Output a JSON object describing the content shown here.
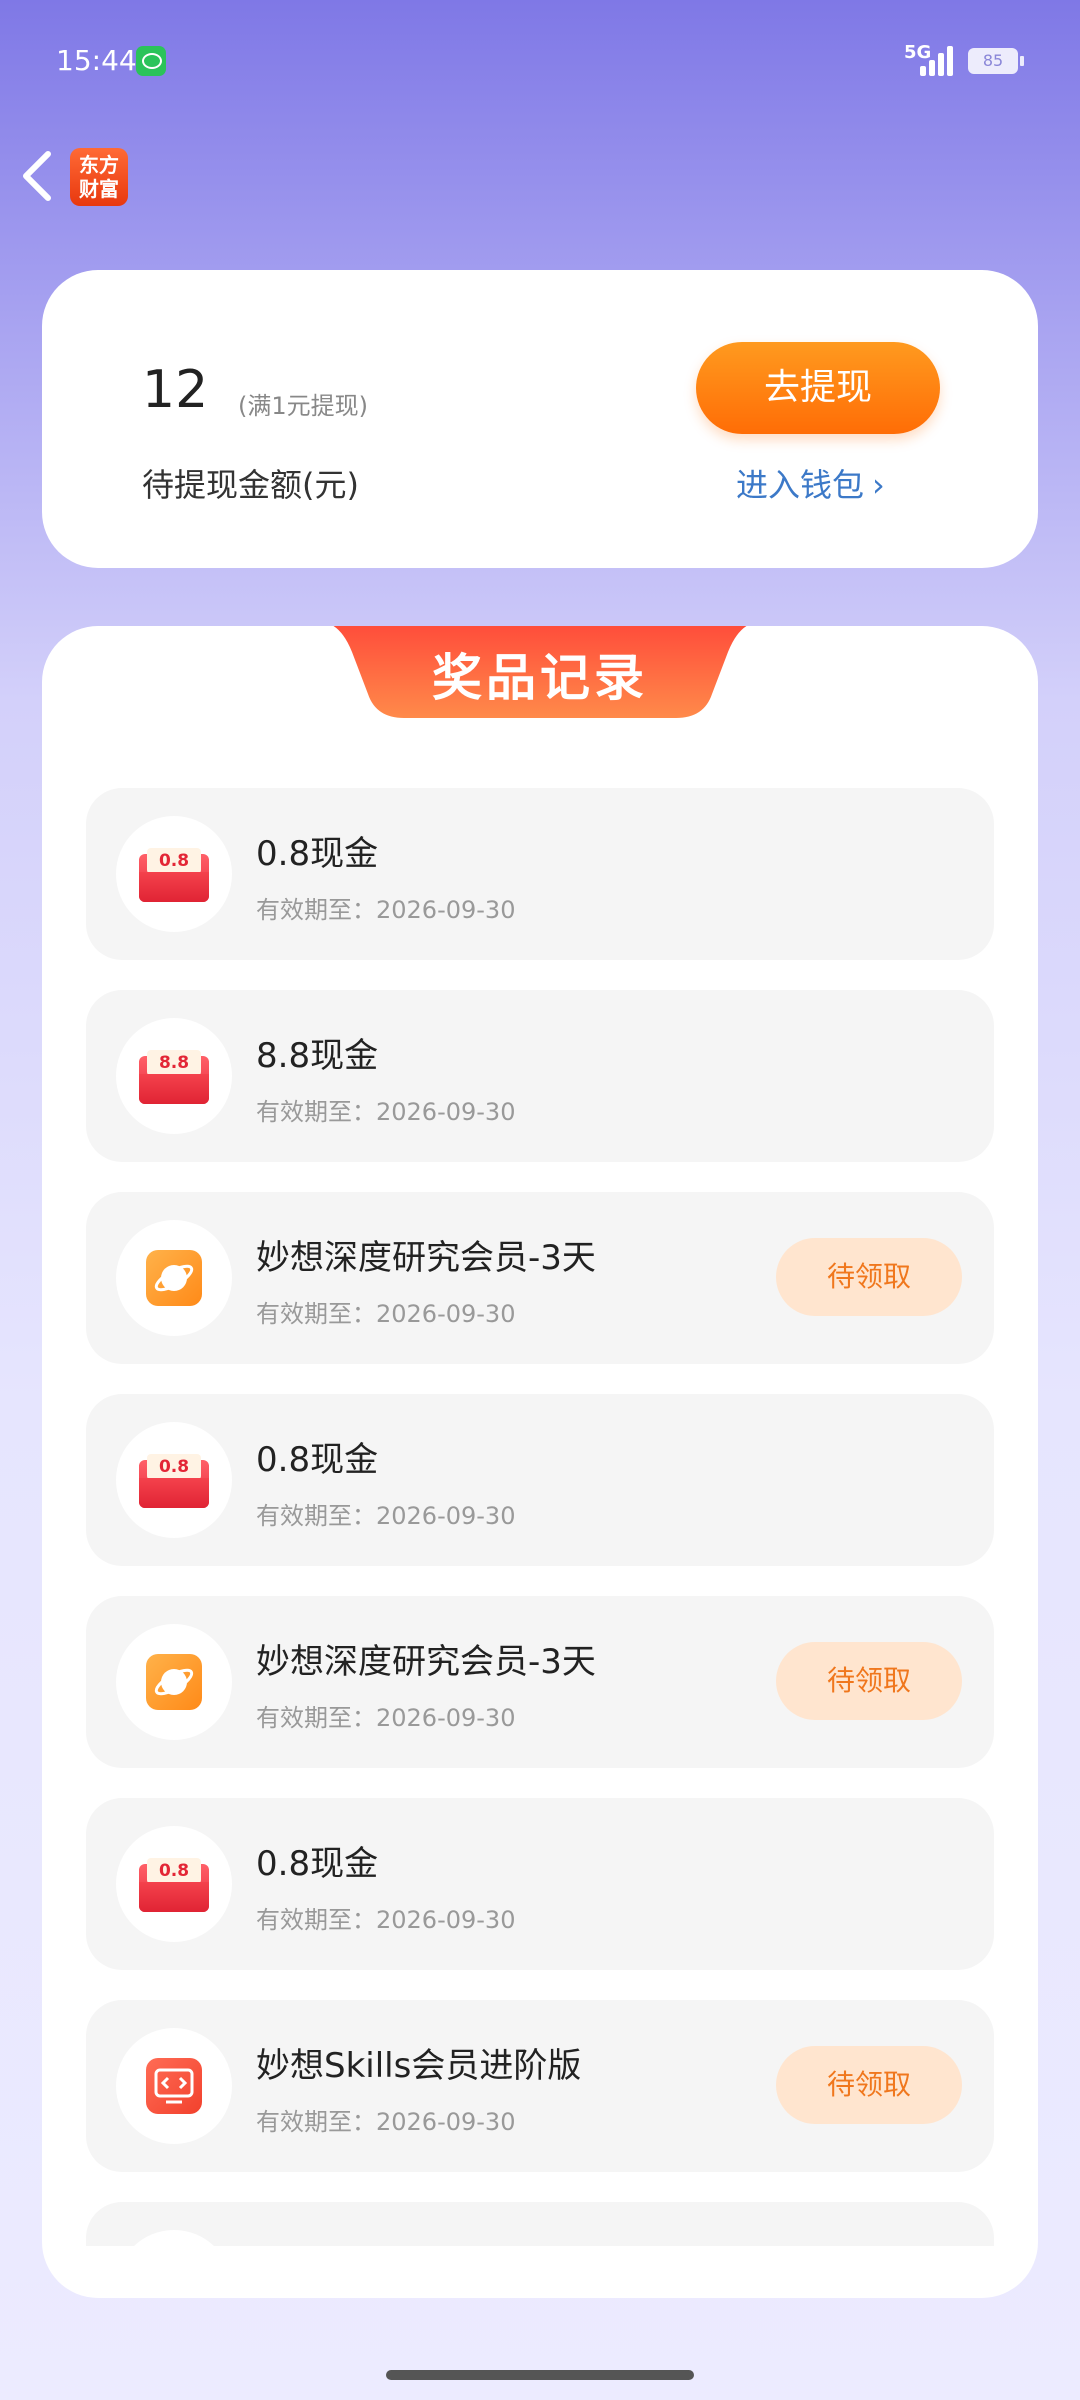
{
  "status_bar": {
    "time": "15:44",
    "network": "5G",
    "battery": "85"
  },
  "header": {
    "logo_text": "东方\n财富"
  },
  "wallet": {
    "amount": "12",
    "amount_note": "(满1元提现)",
    "amount_label": "待提现金额(元)",
    "withdraw_button": "去提现",
    "wallet_link": "进入钱包"
  },
  "records": {
    "title": "奖品记录",
    "items": [
      {
        "name": "0.8现金",
        "expiry": "有效期至：2026-09-30",
        "icon": "red-packet-icon",
        "badge": "0.8",
        "action": ""
      },
      {
        "name": "8.8现金",
        "expiry": "有效期至：2026-09-30",
        "icon": "red-packet-icon",
        "badge": "8.8",
        "action": ""
      },
      {
        "name": "妙想深度研究会员-3天",
        "expiry": "有效期至：2026-09-30",
        "icon": "planet-icon",
        "badge": "",
        "action": "待领取"
      },
      {
        "name": "0.8现金",
        "expiry": "有效期至：2026-09-30",
        "icon": "red-packet-icon",
        "badge": "0.8",
        "action": ""
      },
      {
        "name": "妙想深度研究会员-3天",
        "expiry": "有效期至：2026-09-30",
        "icon": "planet-icon",
        "badge": "",
        "action": "待领取"
      },
      {
        "name": "0.8现金",
        "expiry": "有效期至：2026-09-30",
        "icon": "red-packet-icon",
        "badge": "0.8",
        "action": ""
      },
      {
        "name": "妙想Skills会员进阶版",
        "expiry": "有效期至：2026-09-30",
        "icon": "code-icon",
        "badge": "",
        "action": "待领取"
      }
    ]
  },
  "colors": {
    "accent_orange": "#ff7a0e",
    "link_blue": "#3c79c8",
    "claim_bg": "#ffe5cf"
  }
}
